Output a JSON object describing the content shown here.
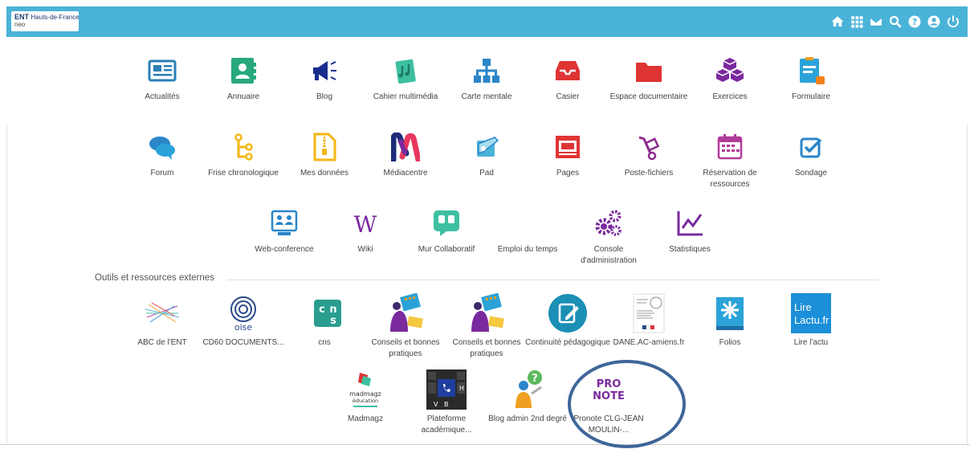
{
  "topbar": {
    "logo_line1_bold": "ENT",
    "logo_line1_rest": "Hauts-de-France",
    "logo_line2": "neo",
    "icons": [
      "home-icon",
      "apps-grid-icon",
      "mail-icon",
      "search-icon",
      "help-icon",
      "account-icon",
      "power-icon"
    ],
    "color": "#4ab3d8"
  },
  "apps": [
    {
      "label": "Actualités",
      "icon": "newspaper-icon"
    },
    {
      "label": "Annuaire",
      "icon": "address-book-icon"
    },
    {
      "label": "Blog",
      "icon": "megaphone-icon"
    },
    {
      "label": "Cahier multimédia",
      "icon": "notebook-music-icon"
    },
    {
      "label": "Carte mentale",
      "icon": "sitemap-icon"
    },
    {
      "label": "Casier",
      "icon": "inbox-tray-icon"
    },
    {
      "label": "Espace documentaire",
      "icon": "folder-icon"
    },
    {
      "label": "Exercices",
      "icon": "cubes-icon"
    },
    {
      "label": "Formulaire",
      "icon": "form-icon"
    },
    {
      "label": "Forum",
      "icon": "chat-bubbles-icon"
    },
    {
      "label": "Frise chronologique",
      "icon": "timeline-icon"
    },
    {
      "label": "Mes données",
      "icon": "zip-file-icon"
    },
    {
      "label": "Médiacentre",
      "icon": "mediacentre-logo-icon"
    },
    {
      "label": "Pad",
      "icon": "pad-icon"
    },
    {
      "label": "Pages",
      "icon": "pages-icon"
    },
    {
      "label": "Poste-fichiers",
      "icon": "hand-truck-icon"
    },
    {
      "label": "Réservation de ressources",
      "icon": "calendar-icon"
    },
    {
      "label": "Sondage",
      "icon": "checkbox-icon"
    },
    {
      "label": "Web-conference",
      "icon": "web-conference-icon"
    },
    {
      "label": "Wiki",
      "icon": "wiki-icon"
    },
    {
      "label": "Mur Collaboratif",
      "icon": "collaborative-wall-icon"
    },
    {
      "label": "Emploi du temps",
      "icon": "timetable-icon"
    },
    {
      "label": "Console d'administration",
      "icon": "gears-icon"
    },
    {
      "label": "Statistiques",
      "icon": "line-chart-icon"
    }
  ],
  "external": {
    "title": "Outils et ressources externes",
    "items": [
      {
        "label": "ABC de l'ENT",
        "icon": "abc-ent-logo-icon"
      },
      {
        "label": "CD60 DOCUMENTS...",
        "icon": "oise-logo-icon"
      },
      {
        "label": "cns",
        "icon": "cns-logo-icon"
      },
      {
        "label": "Conseils et bonnes pratiques",
        "icon": "advice-illustration-icon"
      },
      {
        "label": "Conseils et bonnes pratiques",
        "icon": "advice-illustration-icon"
      },
      {
        "label": "Continuité pédagogique",
        "icon": "edit-circle-icon"
      },
      {
        "label": "DANE.AC-amiens.fr",
        "icon": "dane-document-icon"
      },
      {
        "label": "Folios",
        "icon": "folios-logo-icon"
      },
      {
        "label": "Lire l'actu",
        "icon": "lire-lactu-logo-icon",
        "logo_text_1": "Lire",
        "logo_text_2": "Lactu.fr"
      },
      {
        "label": "Madmagz",
        "icon": "madmagz-logo-icon",
        "logo_text_1": "madmagz",
        "logo_text_2": "éducation"
      },
      {
        "label": "Plateforme académique...",
        "icon": "keyboard-key-icon"
      },
      {
        "label": "Blog admin 2nd degré",
        "icon": "question-person-icon"
      },
      {
        "label": "Pronote CLG-JEAN MOULIN-...",
        "icon": "pronote-logo-icon",
        "logo_text_1": "PRO",
        "logo_text_2": "NOTE"
      }
    ]
  },
  "annotation": {
    "shape": "ellipse",
    "color": "#3e6698"
  }
}
